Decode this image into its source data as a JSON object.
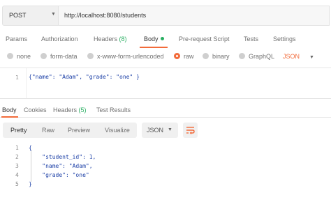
{
  "request": {
    "method": "POST",
    "url": "http://localhost:8080/students"
  },
  "request_tabs": {
    "params": "Params",
    "authorization": "Authorization",
    "headers": "Headers",
    "headers_count": "(8)",
    "body": "Body",
    "prerequest": "Pre-request Script",
    "tests": "Tests",
    "settings": "Settings"
  },
  "body_types": {
    "none": "none",
    "form_data": "form-data",
    "urlencoded": "x-www-form-urlencoded",
    "raw": "raw",
    "binary": "binary",
    "graphql": "GraphQL",
    "format": "JSON",
    "selected": "raw"
  },
  "request_editor": {
    "line": "1",
    "code": "{\"name\": \"Adam\", \"grade\": \"one\" }"
  },
  "response_tabs": {
    "body": "Body",
    "cookies": "Cookies",
    "headers": "Headers",
    "headers_count": "(5)",
    "test_results": "Test Results"
  },
  "view": {
    "pretty": "Pretty",
    "raw": "Raw",
    "preview": "Preview",
    "visualize": "Visualize",
    "format": "JSON"
  },
  "response_body": {
    "lines": [
      {
        "num": "1",
        "text": "{"
      },
      {
        "num": "2",
        "text": "    \"student_id\": 1,"
      },
      {
        "num": "3",
        "text": "    \"name\": \"Adam\","
      },
      {
        "num": "4",
        "text": "    \"grade\": \"one\""
      },
      {
        "num": "5",
        "text": "}"
      }
    ]
  },
  "colors": {
    "accent": "#f26b3a",
    "count": "#27ae60",
    "code": "#1a3ea6"
  }
}
